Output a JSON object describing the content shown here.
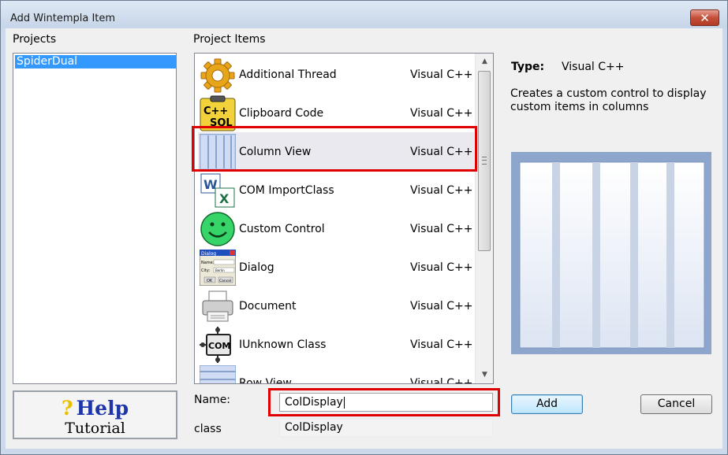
{
  "window": {
    "title": "Add Wintempla Item",
    "close_glyph": "✕"
  },
  "projects": {
    "label": "Projects",
    "items": [
      "SpiderDual"
    ]
  },
  "project_items": {
    "label": "Project Items",
    "items": [
      {
        "name": "Additional Thread",
        "type": "Visual C++",
        "icon": "gear-icon"
      },
      {
        "name": "Clipboard Code",
        "type": "Visual C++",
        "icon": "clipboard-cpp-sql-icon"
      },
      {
        "name": "Column View",
        "type": "Visual C++",
        "icon": "column-view-icon"
      },
      {
        "name": "COM ImportClass",
        "type": "Visual C++",
        "icon": "word-excel-icon"
      },
      {
        "name": "Custom Control",
        "type": "Visual C++",
        "icon": "smiley-icon"
      },
      {
        "name": "Dialog",
        "type": "Visual C++",
        "icon": "dialog-icon"
      },
      {
        "name": "Document",
        "type": "Visual C++",
        "icon": "printer-icon"
      },
      {
        "name": "IUnknown Class",
        "type": "Visual C++",
        "icon": "com-chip-icon"
      },
      {
        "name": "Row View",
        "type": "Visual C++",
        "icon": "row-view-icon"
      }
    ],
    "selected": "Column View"
  },
  "icon_text": {
    "cpp": "C++",
    "sql": "SQL",
    "com": "COM",
    "dialog_title": "Dialog",
    "name_lbl": "Name:",
    "city_lbl": "City:",
    "city_val": "Berlin",
    "ok": "OK",
    "cancel": "Cancel"
  },
  "details": {
    "type_label": "Type:",
    "type_value": "Visual C++",
    "description_line1": "Creates a custom control to display",
    "description_line2": "custom items in columns"
  },
  "tutorial": {
    "help": "Help",
    "help_glyph": "?",
    "tutorial": "Tutorial"
  },
  "form": {
    "name_label": "Name:",
    "name_value": "ColDisplay",
    "class_label": "class",
    "class_value": "ColDisplay"
  },
  "buttons": {
    "add": "Add",
    "cancel": "Cancel"
  },
  "scrollbar": {
    "up": "▲",
    "down": "▼"
  },
  "colors": {
    "selection": "#3399ff",
    "highlight_box": "#e00000",
    "help_text": "#1f36a8"
  }
}
